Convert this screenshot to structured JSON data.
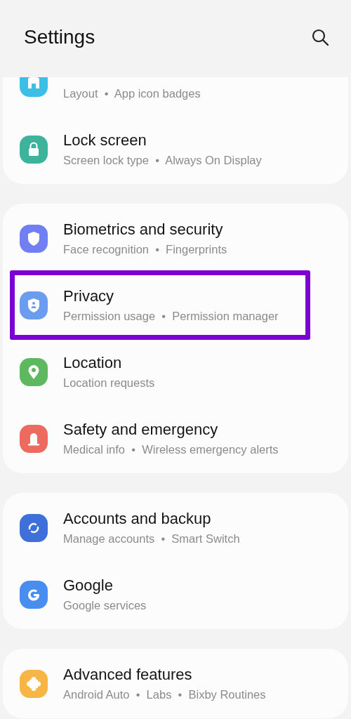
{
  "header": {
    "title": "Settings"
  },
  "groups": [
    {
      "items": [
        {
          "kind": "home",
          "color": "#3cbfe6",
          "subtitle": "Layout  •  App icon badges",
          "highlighted": false
        },
        {
          "kind": "lock",
          "color": "#3db39b",
          "title": "Lock screen",
          "subtitle": "Screen lock type  •  Always On Display",
          "highlighted": false
        }
      ]
    },
    {
      "items": [
        {
          "kind": "shield",
          "color": "#707ff2",
          "title": "Biometrics and security",
          "subtitle": "Face recognition  •  Fingerprints",
          "highlighted": false
        },
        {
          "kind": "privacy",
          "color": "#6c9cf0",
          "title": "Privacy",
          "subtitle": "Permission usage  •  Permission manager",
          "highlighted": true
        },
        {
          "kind": "location",
          "color": "#5db85f",
          "title": "Location",
          "subtitle": "Location requests",
          "highlighted": false
        },
        {
          "kind": "alert",
          "color": "#ec6a5e",
          "title": "Safety and emergency",
          "subtitle": "Medical info  •  Wireless emergency alerts",
          "highlighted": false
        }
      ]
    },
    {
      "items": [
        {
          "kind": "sync",
          "color": "#3f6fd9",
          "title": "Accounts and backup",
          "subtitle": "Manage accounts  •  Smart Switch",
          "highlighted": false
        },
        {
          "kind": "google",
          "color": "#4a8df0",
          "title": "Google",
          "subtitle": "Google services",
          "highlighted": false
        }
      ]
    },
    {
      "items": [
        {
          "kind": "puzzle",
          "color": "#f6b545",
          "title": "Advanced features",
          "subtitle": "Android Auto  •  Labs  •  Bixby Routines",
          "highlighted": false
        }
      ]
    }
  ]
}
